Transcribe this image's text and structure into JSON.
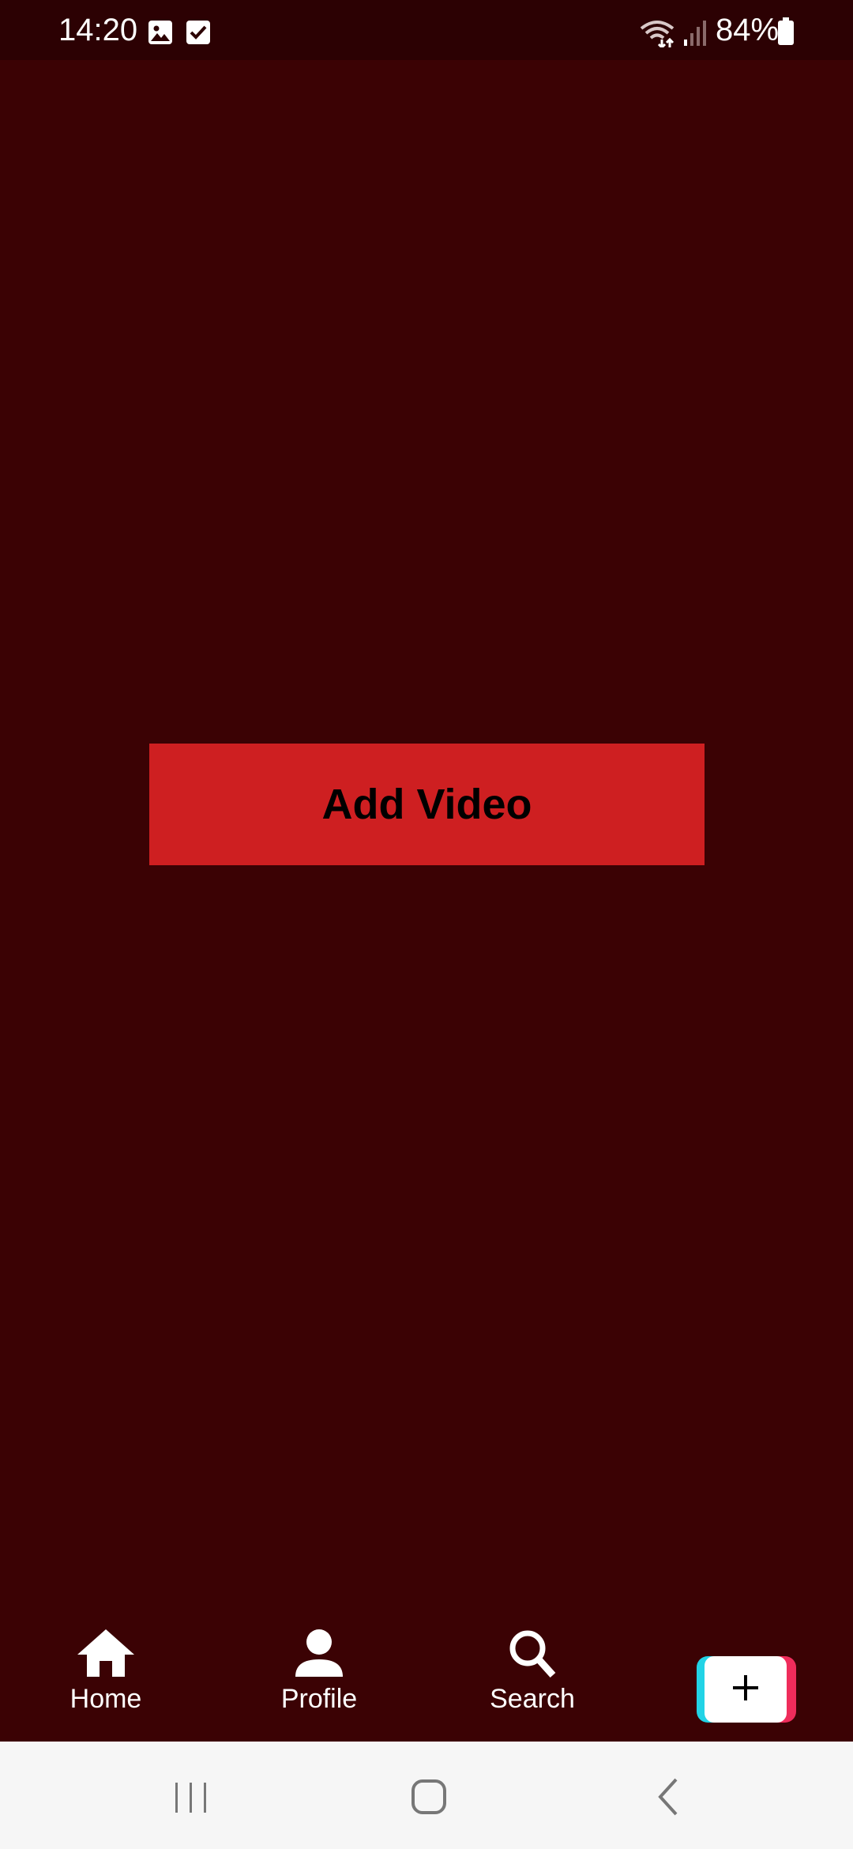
{
  "status_bar": {
    "time": "14:20",
    "battery_percent": "84%",
    "icons": [
      "image-icon",
      "checkbox-icon",
      "wifi-icon",
      "signal-icon",
      "battery-icon"
    ]
  },
  "main": {
    "add_video_label": "Add Video",
    "background_color": "#3b0204",
    "button_color": "#ce1f21"
  },
  "bottom_nav": {
    "items": [
      {
        "label": "Home",
        "icon": "home-icon"
      },
      {
        "label": "Profile",
        "icon": "person-icon"
      },
      {
        "label": "Search",
        "icon": "search-icon"
      }
    ],
    "create_icon": "plus-icon",
    "accent_cyan": "#22d3e6",
    "accent_pink": "#ef2c5b"
  },
  "system_nav": {
    "icons": [
      "recent-apps-icon",
      "home-circle-icon",
      "back-icon"
    ]
  }
}
